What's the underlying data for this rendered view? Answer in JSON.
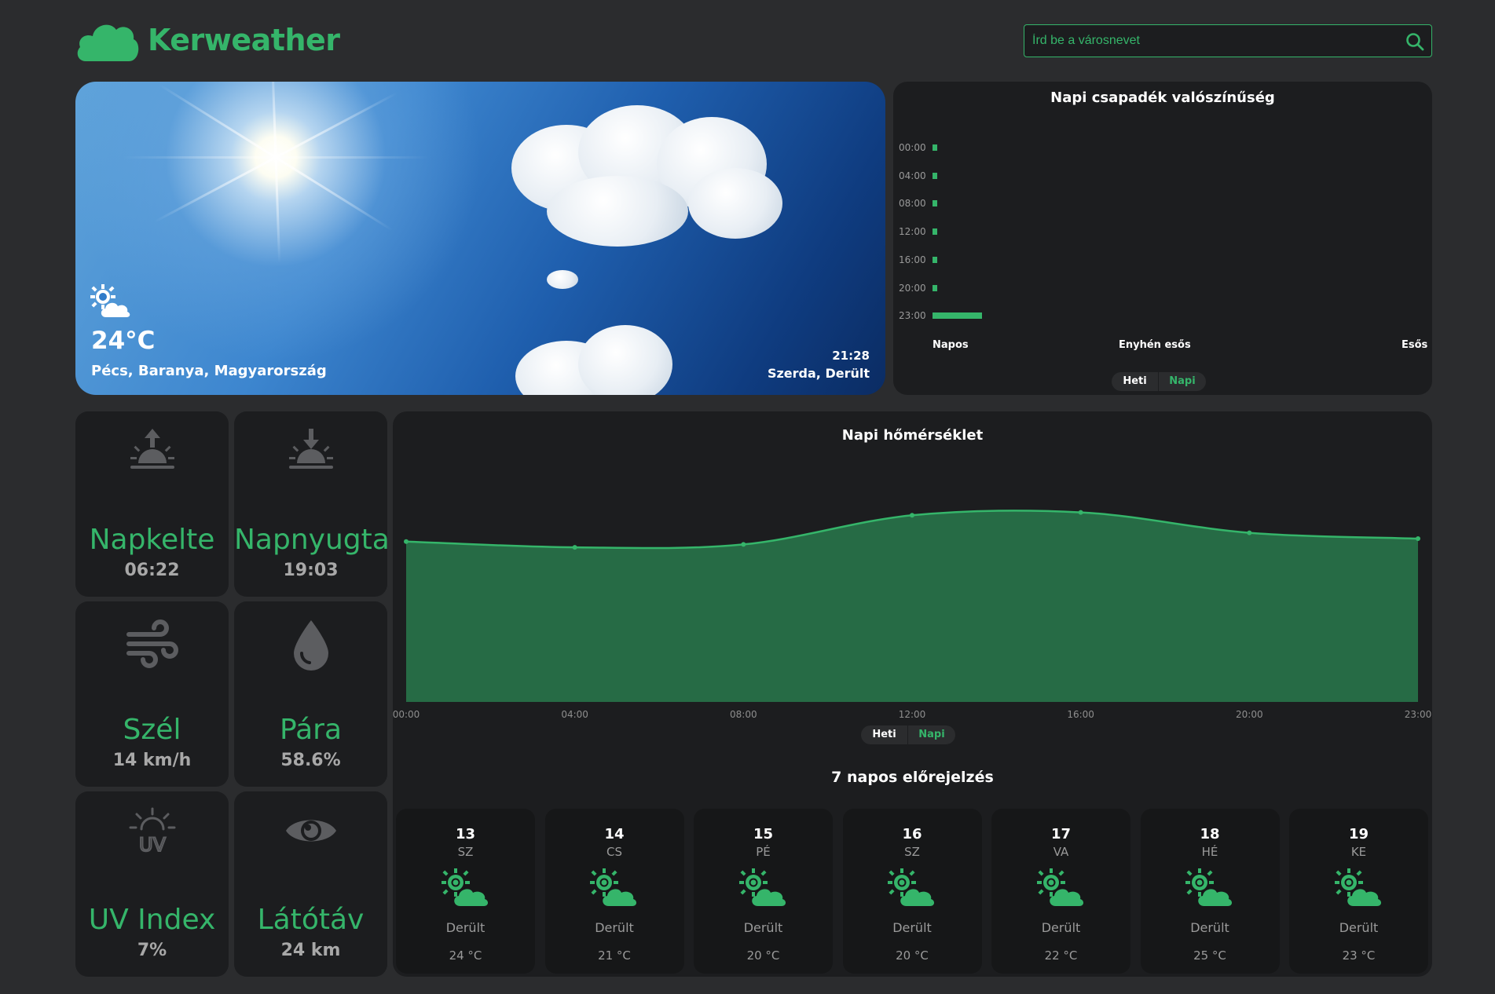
{
  "brand": {
    "name": "Kerweather",
    "accent": "#35b56a"
  },
  "search": {
    "placeholder": "Írd be a városnevet",
    "icon": "search-icon"
  },
  "hero": {
    "icon": "sun-cloud-icon",
    "temperature": "24°C",
    "location": "Pécs, Baranya, Magyarország",
    "time": "21:28",
    "day_condition": "Szerda, Derült"
  },
  "precipitation": {
    "title": "Napi csapadék valószínűség",
    "toggle": {
      "heti": "Heti",
      "napi": "Napi",
      "active": "Napi"
    },
    "chart_data": {
      "type": "bar",
      "orientation": "horizontal",
      "title": "Napi csapadék valószínűség",
      "categories": [
        "00:00",
        "04:00",
        "08:00",
        "12:00",
        "16:00",
        "20:00",
        "23:00"
      ],
      "values": [
        0,
        0,
        0,
        0,
        0,
        0,
        0.1
      ],
      "x_tick_labels": [
        "Napos",
        "Enyhén esős",
        "Esős"
      ],
      "xlim": [
        0,
        1
      ]
    }
  },
  "stats": [
    {
      "icon": "sunrise-icon",
      "title": "Napkelte",
      "value": "06:22"
    },
    {
      "icon": "sunset-icon",
      "title": "Napnyugta",
      "value": "19:03"
    },
    {
      "icon": "wind-icon",
      "title": "Szél",
      "value": "14 km/h"
    },
    {
      "icon": "humidity-drop-icon",
      "title": "Pára",
      "value": "58.6%"
    },
    {
      "icon": "uv-icon",
      "title": "UV Index",
      "value": "7%"
    },
    {
      "icon": "eye-icon",
      "title": "Látótáv",
      "value": "24 km"
    }
  ],
  "temperature_chart": {
    "title": "Napi hőmérséklet",
    "toggle": {
      "heti": "Heti",
      "napi": "Napi",
      "active": "Napi"
    },
    "chart_data": {
      "type": "area",
      "title": "Napi hőmérséklet",
      "x": [
        "00:00",
        "04:00",
        "08:00",
        "12:00",
        "16:00",
        "20:00",
        "23:00"
      ],
      "y": [
        19.0,
        18.6,
        18.8,
        20.8,
        21.0,
        19.6,
        19.2
      ],
      "ylim": [
        8,
        22
      ],
      "grid": false,
      "legend": "none",
      "color": "#35b56a",
      "fill": "#266b45"
    }
  },
  "forecast": {
    "title": "7 napos előrejelzés",
    "days": [
      {
        "num": "13",
        "name": "SZ",
        "condition": "Derült",
        "temp": "24 °C",
        "icon": "sun-cloud-icon"
      },
      {
        "num": "14",
        "name": "CS",
        "condition": "Derült",
        "temp": "21 °C",
        "icon": "sun-cloud-icon"
      },
      {
        "num": "15",
        "name": "PÉ",
        "condition": "Derült",
        "temp": "20 °C",
        "icon": "sun-cloud-icon"
      },
      {
        "num": "16",
        "name": "SZ",
        "condition": "Derült",
        "temp": "20 °C",
        "icon": "sun-cloud-icon"
      },
      {
        "num": "17",
        "name": "VA",
        "condition": "Derült",
        "temp": "22 °C",
        "icon": "sun-cloud-icon"
      },
      {
        "num": "18",
        "name": "HÉ",
        "condition": "Derült",
        "temp": "25 °C",
        "icon": "sun-cloud-icon"
      },
      {
        "num": "19",
        "name": "KE",
        "condition": "Derült",
        "temp": "23 °C",
        "icon": "sun-cloud-icon"
      }
    ]
  }
}
